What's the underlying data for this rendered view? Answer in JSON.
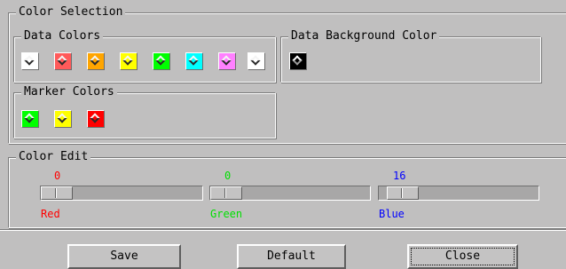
{
  "color_selection": {
    "legend": "Color Selection",
    "data_colors": {
      "legend": "Data Colors",
      "swatches": [
        {
          "color": "#ffffff",
          "name": "white"
        },
        {
          "color": "#ff5a5a",
          "name": "red"
        },
        {
          "color": "#ffa500",
          "name": "orange"
        },
        {
          "color": "#ffff00",
          "name": "yellow"
        },
        {
          "color": "#00ff00",
          "name": "green"
        },
        {
          "color": "#00ffff",
          "name": "cyan"
        },
        {
          "color": "#ff80ff",
          "name": "magenta"
        },
        {
          "color": "#ffffff",
          "name": "white"
        }
      ]
    },
    "data_background": {
      "legend": "Data Background Color",
      "swatches": [
        {
          "color": "#000000",
          "name": "black"
        }
      ]
    },
    "marker_colors": {
      "legend": "Marker Colors",
      "swatches": [
        {
          "color": "#00ff00",
          "name": "green"
        },
        {
          "color": "#ffff00",
          "name": "yellow"
        },
        {
          "color": "#ff0000",
          "name": "red"
        }
      ]
    }
  },
  "color_edit": {
    "legend": "Color Edit",
    "sliders": [
      {
        "label": "Red",
        "value": "0",
        "color": "#ff0000",
        "fraction": 0
      },
      {
        "label": "Green",
        "value": "0",
        "color": "#00e000",
        "fraction": 0
      },
      {
        "label": "Blue",
        "value": "16",
        "color": "#0000ff",
        "fraction": 0.063
      }
    ]
  },
  "buttons": {
    "save": "Save",
    "default": "Default",
    "close": "Close"
  }
}
